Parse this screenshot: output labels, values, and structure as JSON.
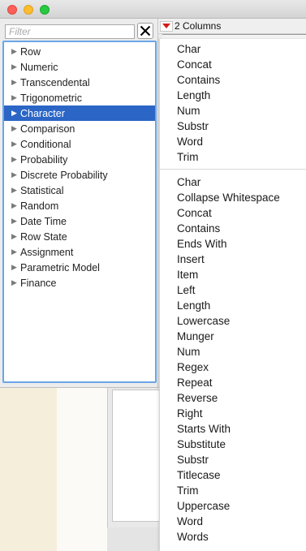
{
  "window": {
    "traffic_lights": [
      "close",
      "minimize",
      "zoom"
    ]
  },
  "filter": {
    "placeholder": "Filter",
    "value": "",
    "clear_icon": "close-x-icon"
  },
  "categories": [
    {
      "label": "Row",
      "selected": false
    },
    {
      "label": "Numeric",
      "selected": false
    },
    {
      "label": "Transcendental",
      "selected": false
    },
    {
      "label": "Trigonometric",
      "selected": false
    },
    {
      "label": "Character",
      "selected": true
    },
    {
      "label": "Comparison",
      "selected": false
    },
    {
      "label": "Conditional",
      "selected": false
    },
    {
      "label": "Probability",
      "selected": false
    },
    {
      "label": "Discrete Probability",
      "selected": false
    },
    {
      "label": "Statistical",
      "selected": false
    },
    {
      "label": "Random",
      "selected": false
    },
    {
      "label": "Date Time",
      "selected": false
    },
    {
      "label": "Row State",
      "selected": false
    },
    {
      "label": "Assignment",
      "selected": false
    },
    {
      "label": "Parametric Model",
      "selected": false
    },
    {
      "label": "Finance",
      "selected": false
    }
  ],
  "columns_header": {
    "label": "2 Columns",
    "accent": "#d21a1a"
  },
  "menu": {
    "recent": [
      "Char",
      "Concat",
      "Contains",
      "Length",
      "Num",
      "Substr",
      "Word",
      "Trim"
    ],
    "all": [
      "Char",
      "Collapse Whitespace",
      "Concat",
      "Contains",
      "Ends With",
      "Insert",
      "Item",
      "Left",
      "Length",
      "Lowercase",
      "Munger",
      "Num",
      "Regex",
      "Repeat",
      "Reverse",
      "Right",
      "Starts With",
      "Substitute",
      "Substr",
      "Titlecase",
      "Trim",
      "Uppercase",
      "Word",
      "Words"
    ]
  },
  "colors": {
    "selection": "#2b66c6",
    "focus_border": "#6aa6e6"
  }
}
